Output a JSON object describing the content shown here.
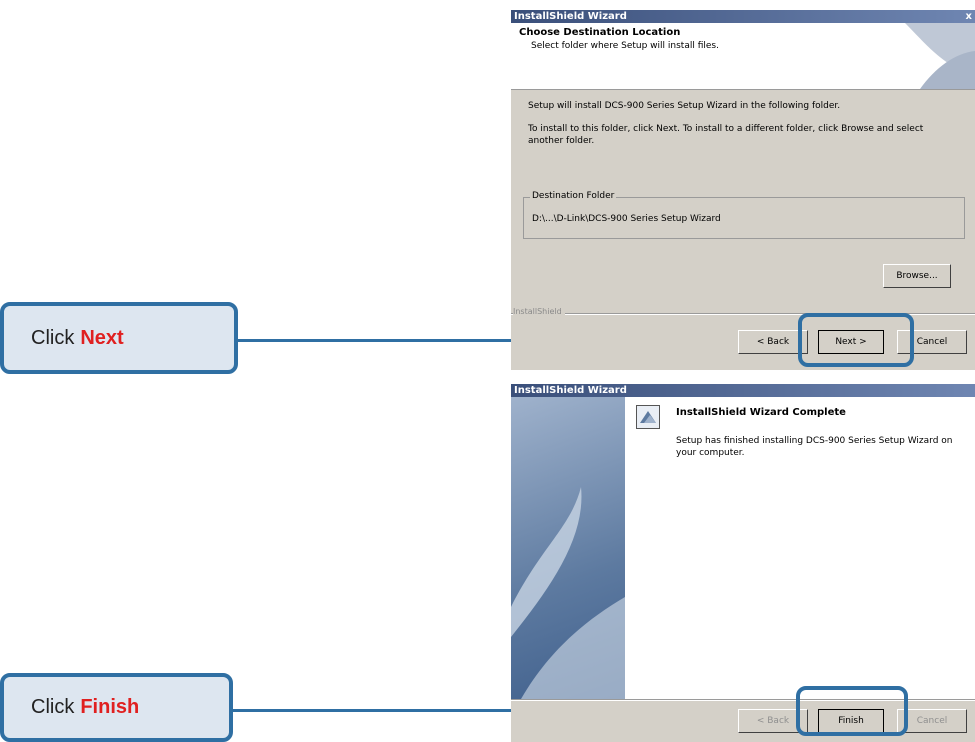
{
  "callouts": {
    "next": {
      "prefix": "Click",
      "action": "Next"
    },
    "finish": {
      "prefix": "Click",
      "action": "Finish"
    }
  },
  "dialog1": {
    "title": "InstallShield Wizard",
    "close_glyph": "x",
    "header_title": "Choose Destination Location",
    "header_subtitle": "Select folder where Setup will install files.",
    "line1": "Setup will install DCS-900 Series Setup Wizard in the following folder.",
    "line2": "To install to this folder, click Next. To install to a different folder, click Browse and select another folder.",
    "group_label": "Destination Folder",
    "folder_path": "D:\\...\\D-Link\\DCS-900 Series Setup Wizard",
    "browse_label": "Browse...",
    "brand": "InstallShield",
    "back_label": "< Back",
    "next_label": "Next >",
    "cancel_label": "Cancel"
  },
  "dialog2": {
    "title": "InstallShield Wizard",
    "heading": "InstallShield Wizard Complete",
    "message": "Setup has finished installing DCS-900 Series Setup Wizard on your computer.",
    "back_label": "< Back",
    "finish_label": "Finish",
    "cancel_label": "Cancel"
  },
  "colors": {
    "accent": "#2f6fa3",
    "highlight": "#e02020",
    "callout_bg": "#dde6f0"
  }
}
